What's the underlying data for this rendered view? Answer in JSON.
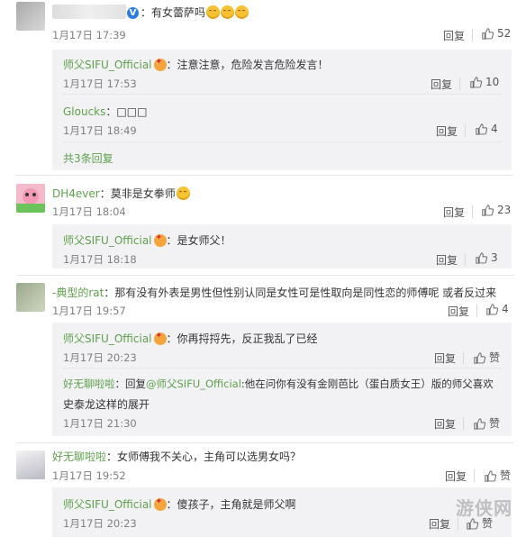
{
  "comments": [
    {
      "user": "",
      "text": "：有女蕾萨吗",
      "time": "1月17日 17:39",
      "reply": "回复",
      "likes": "52",
      "replies": [
        {
          "user": "师父SIFU_Official",
          "text": "：注意注意，危险发言危险发言！",
          "time": "1月17日 17:53",
          "reply": "回复",
          "likes": "10"
        },
        {
          "user": "Gloucks",
          "text": "：□□□",
          "time": "1月17日 18:49",
          "reply": "回复",
          "likes": "4"
        }
      ],
      "more": "共3条回复"
    },
    {
      "user": "DH4ever",
      "text": "：莫非是女拳师",
      "time": "1月17日 18:04",
      "reply": "回复",
      "likes": "23",
      "replies": [
        {
          "user": "师父SIFU_Official",
          "text": "：是女师父！",
          "time": "1月17日 18:18",
          "reply": "回复",
          "likes": "3"
        }
      ]
    },
    {
      "user": "-典型的rat",
      "text": "：那有没有外表是男性但性别认同是女性可是性取向是同性恋的师傅呢 或者反过来",
      "time": "1月17日 19:57",
      "reply": "回复",
      "likes": "4",
      "replies": [
        {
          "user": "师父SIFU_Official",
          "text": "：你再捋捋先，反正我乱了已经",
          "time": "1月17日 20:23",
          "reply": "回复",
          "likes": "赞"
        },
        {
          "user": "好无聊啦啦",
          "text_prefix": "：回复",
          "mention": "@师父SIFU_Official",
          "text_line1": ":他在问你有没有金刚芭比（蛋白质女王）版的师父喜欢",
          "text_line2": "史泰龙这样的展开",
          "time": "1月17日 21:30",
          "reply": "回复",
          "likes": "赞"
        }
      ]
    },
    {
      "user": "好无聊啦啦",
      "text": "：女师傅我不关心，主角可以选男女吗？",
      "time": "1月17日 19:52",
      "reply": "回复",
      "likes": "赞",
      "replies": [
        {
          "user": "师父SIFU_Official",
          "text": "：傻孩子，主角就是师父啊",
          "time": "1月17日 20:23",
          "reply": "回复",
          "likes": "赞"
        }
      ]
    }
  ],
  "watermark": "游侠网",
  "colors": {
    "username": "#eb7350",
    "green": "#5fa04c",
    "sub_bg": "#f2f2f5",
    "mention": "#eb7350"
  }
}
